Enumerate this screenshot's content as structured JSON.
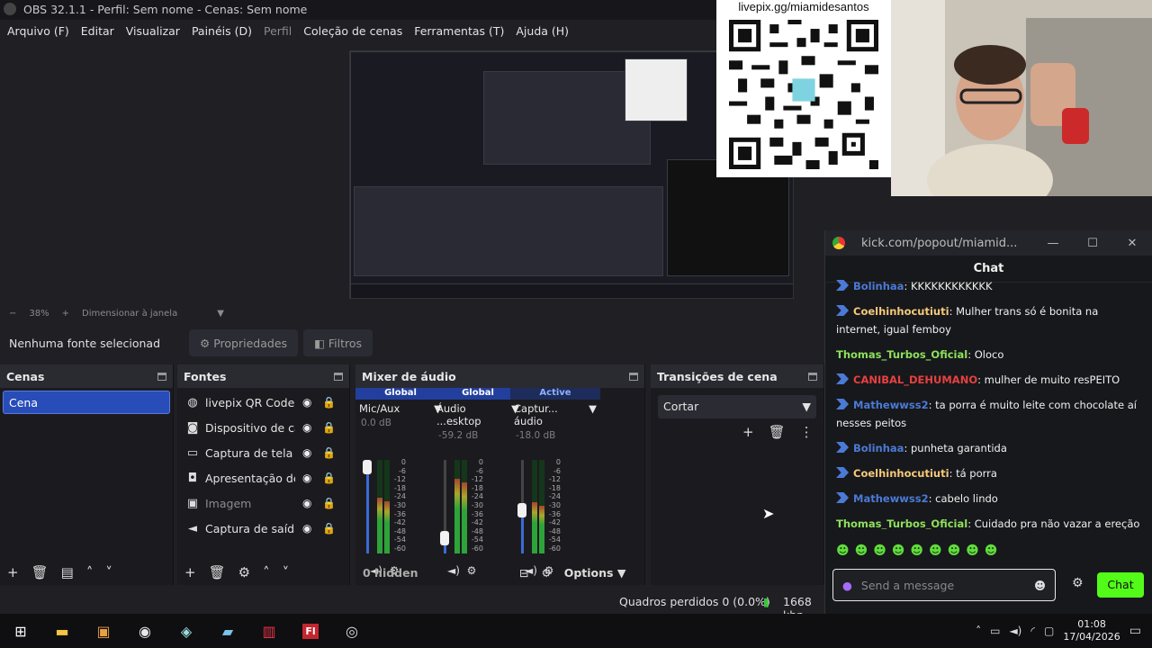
{
  "window": {
    "title": "OBS 32.1.1 - Perfil: Sem nome - Cenas: Sem nome"
  },
  "menu": [
    {
      "label": "Arquivo (F)",
      "enabled": true
    },
    {
      "label": "Editar",
      "enabled": true
    },
    {
      "label": "Visualizar",
      "enabled": true
    },
    {
      "label": "Painéis (D)",
      "enabled": true
    },
    {
      "label": "Perfil",
      "enabled": false
    },
    {
      "label": "Coleção de cenas",
      "enabled": true
    },
    {
      "label": "Ferramentas (T)",
      "enabled": true
    },
    {
      "label": "Ajuda (H)",
      "enabled": true
    }
  ],
  "overlay": {
    "qr_caption": "livepix.gg/miamidesantos"
  },
  "zoom": {
    "minus": "−",
    "value": "38%",
    "plus": "+",
    "mode": "Dimensionar à janela"
  },
  "source_toolbar": {
    "no_source": "Nenhuma fonte selecionad",
    "properties": "Propriedades",
    "filters": "Filtros"
  },
  "scenes": {
    "title": "Cenas",
    "items": [
      "Cena"
    ]
  },
  "sources": {
    "title": "Fontes",
    "items": [
      {
        "label": "livepix QR Code",
        "icon": "globe-icon",
        "glyph": "◍"
      },
      {
        "label": "Dispositivo de ca",
        "icon": "camera-icon",
        "glyph": "◙"
      },
      {
        "label": "Captura de tela",
        "icon": "monitor-icon",
        "glyph": "▭"
      },
      {
        "label": "Apresentação de",
        "icon": "slideshow-icon",
        "glyph": "◘"
      },
      {
        "label": "Imagem",
        "icon": "image-icon",
        "glyph": "▣"
      },
      {
        "label": "Captura de saída",
        "icon": "speaker-icon",
        "glyph": "◄"
      }
    ]
  },
  "mixer": {
    "title": "Mixer de áudio",
    "channels": [
      {
        "tag": "Global",
        "name": "Mic/Aux",
        "db": "0.0 dB",
        "level": 0.6,
        "fader": 0.92
      },
      {
        "tag": "Global",
        "name": "Áudio ...esktop",
        "db": "-59.2 dB",
        "level": 0.8,
        "fader": 0.16
      },
      {
        "tag": "Active",
        "name": "Captur... áudio",
        "db": "-18.0 dB",
        "level": 0.55,
        "fader": 0.46
      }
    ],
    "scale": [
      "0",
      "-6",
      "-12",
      "-18",
      "-24",
      "-30",
      "-36",
      "-42",
      "-48",
      "-54",
      "-60"
    ],
    "hidden": "0 hidden",
    "options": "Options"
  },
  "transitions": {
    "title": "Transições de cena",
    "selected": "Cortar"
  },
  "status": {
    "dropped": "Quadros perdidos 0 (0.0%)",
    "bitrate": "1668 kbp"
  },
  "chat": {
    "url": "kick.com/popout/miamid...",
    "header": "Chat",
    "messages": [
      {
        "user": "Bolinhaa",
        "text": "KKKKKKKKKKKK",
        "color": "#4b7ad6",
        "badge": true
      },
      {
        "user": "Coelhinhocutiuti",
        "text": "Mulher trans só é bonita na internet, igual femboy",
        "color": "#f5c97a",
        "badge": true
      },
      {
        "user": "Thomas_Turbos_Oficial",
        "text": "Oloco",
        "color": "#8ee05c",
        "badge": false
      },
      {
        "user": "CANIBAL_DEHUMANO",
        "text": "mulher de muito resPEITO",
        "color": "#e84040",
        "badge": true
      },
      {
        "user": "Mathewwss2",
        "text": "ta porra é muito leite com chocolate aí nesses peitos",
        "color": "#4b7ad6",
        "badge": true
      },
      {
        "user": "Bolinhaa",
        "text": "punheta garantida",
        "color": "#4b7ad6",
        "badge": true
      },
      {
        "user": "Coelhinhocutiuti",
        "text": "tá porra",
        "color": "#f5c97a",
        "badge": true
      },
      {
        "user": "Mathewwss2",
        "text": "cabelo lindo",
        "color": "#4b7ad6",
        "badge": true
      },
      {
        "user": "Thomas_Turbos_Oficial",
        "text": "Cuidado pra não vazar a ereção aí",
        "color": "#8ee05c",
        "badge": false
      }
    ],
    "emotes": "☻☻☻☻☻☻☻☻☻",
    "placeholder": "Send a message",
    "send": "Chat"
  },
  "taskbar": {
    "time": "01:08",
    "date": "17/04/2026"
  }
}
